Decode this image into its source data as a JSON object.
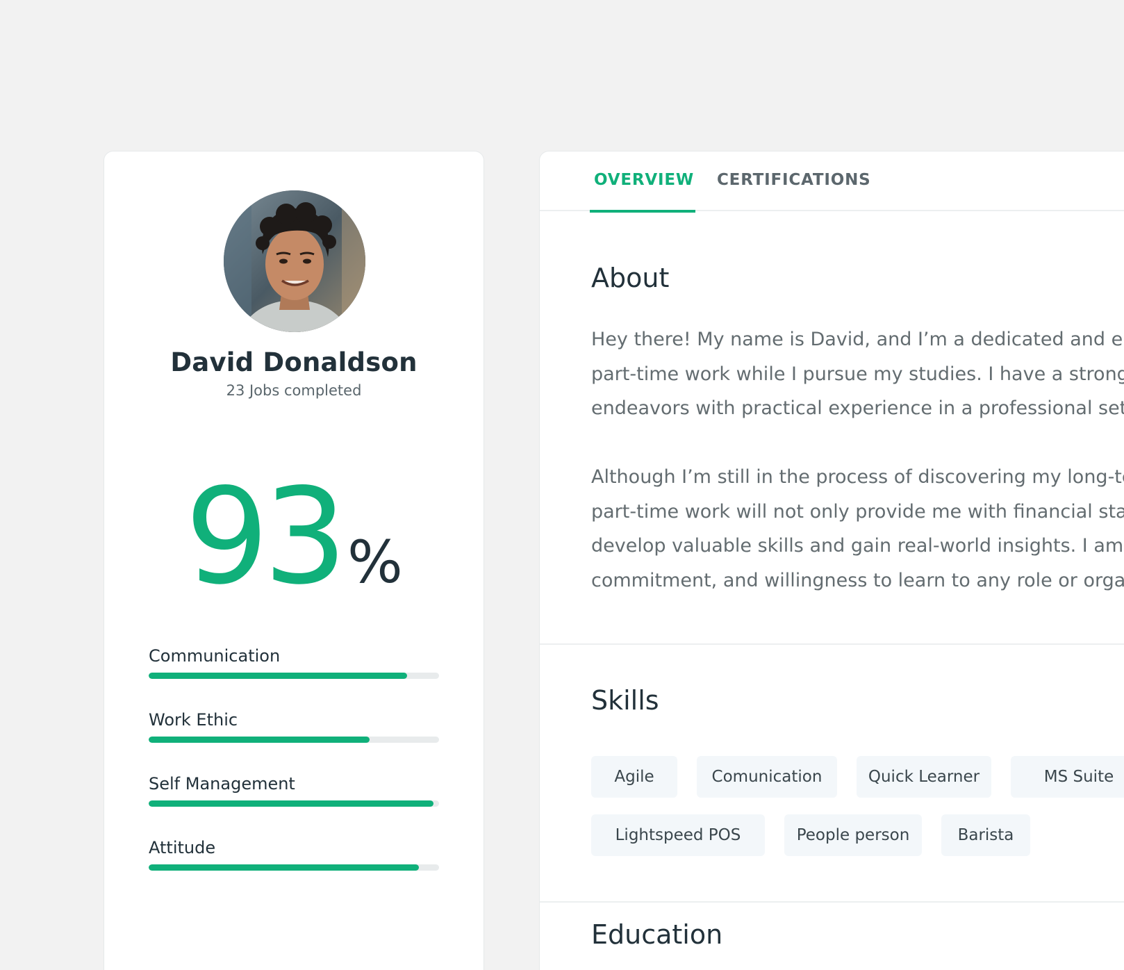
{
  "profile": {
    "name": "David Donaldson",
    "jobs_completed": "23 Jobs completed",
    "score_value": "93",
    "score_unit": "%",
    "ratings": [
      {
        "label": "Communication",
        "level": 0.89
      },
      {
        "label": "Work Ethic",
        "level": 0.76
      },
      {
        "label": "Self Management",
        "level": 0.98
      },
      {
        "label": "Attitude",
        "level": 0.93
      }
    ]
  },
  "tabs": [
    {
      "label": "OVERVIEW",
      "active": true
    },
    {
      "label": "CERTIFICATIONS",
      "active": false
    }
  ],
  "about": {
    "title": "About",
    "paragraph1": [
      "Hey there! My name is David, and I’m a dedicated and ent",
      "part-time work while I pursue my studies. I have a strong c",
      "endeavors with practical experience in a professional settin"
    ],
    "paragraph2": [
      "Although I’m still in the process of discovering my long-te",
      "part-time work will not only provide me with financial stab",
      "develop valuable skills and gain real-world insights. I am e",
      "commitment, and willingness to learn to any role or organ"
    ]
  },
  "skills": {
    "title": "Skills",
    "items": [
      "Agile",
      "Comunication",
      "Quick Learner",
      "MS Suite",
      "Lightspeed POS",
      "People person",
      "Barista"
    ]
  },
  "education": {
    "title": "Education"
  },
  "colors": {
    "accent": "#10b07a",
    "text_dark": "#22313a",
    "text_muted": "#636c70",
    "background": "#f2f2f2",
    "chip_bg": "#f3f7fa"
  }
}
